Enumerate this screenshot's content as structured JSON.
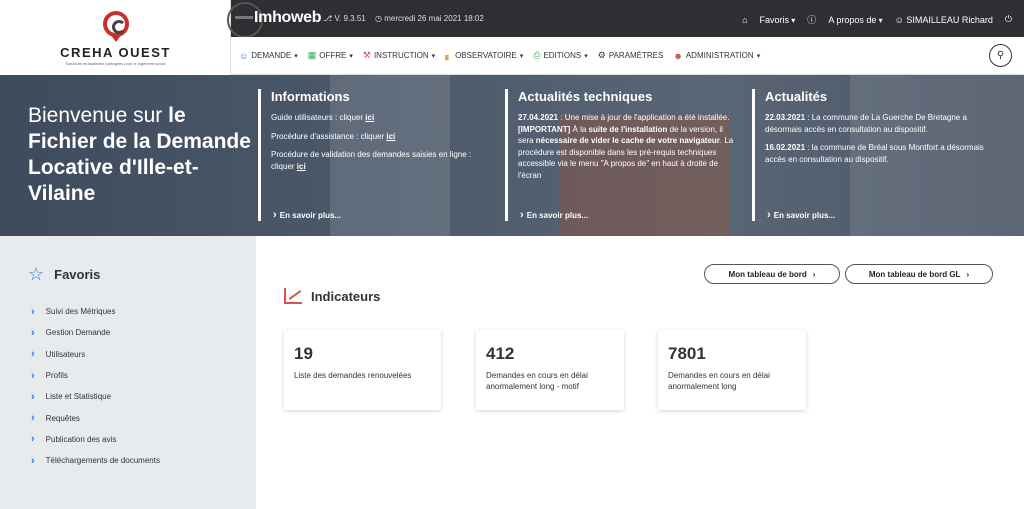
{
  "logo": {
    "name": "CREHA OUEST",
    "tagline": "Solutions mutualisées partagées pour le logement social"
  },
  "topbar": {
    "app_name": "Imhoweb",
    "version": "V. 9.3.51",
    "date": "mercredi 26 mai 2021 18:02",
    "favoris": "Favoris",
    "about": "A propos de",
    "user": "SIMAILLEAU Richard"
  },
  "menu": [
    {
      "label": "DEMANDE",
      "icon": "user-icon"
    },
    {
      "label": "OFFRE",
      "icon": "building-icon"
    },
    {
      "label": "INSTRUCTION",
      "icon": "gavel-icon"
    },
    {
      "label": "OBSERVATOIRE",
      "icon": "chart-icon"
    },
    {
      "label": "EDITIONS",
      "icon": "print-icon"
    },
    {
      "label": "PARAMÈTRES",
      "icon": "cogs-icon"
    },
    {
      "label": "ADMINISTRATION",
      "icon": "users-icon"
    }
  ],
  "hero": {
    "title_light": "Bienvenue sur",
    "title_bold_1": "le",
    "title_bold_2": "Fichier de la Demande Locative d'Ille-et-Vilaine",
    "columns": [
      {
        "title": "Informations",
        "paragraphs": [
          {
            "text": "Guide utilisateurs : cliquer ",
            "link": "ici"
          },
          {
            "text": "Procédure d'assistance : cliquer ",
            "link": "ici"
          },
          {
            "text": "Procédure de validation des demandes saisies en ligne : cliquer ",
            "link": "ici"
          }
        ],
        "more": "En savoir plus..."
      },
      {
        "title": "Actualités techniques",
        "date": "27.04.2021",
        "body": " : Une mise à jour de l'application a été installée.",
        "important": "[IMPORTANT]",
        "body2": " À la ",
        "b1": "suite de l'installation",
        "body3": " de la version, il sera ",
        "b2": "nécessaire de vider le cache de votre navigateur",
        "body4": ". La procédure est disponible dans les pré-requis techniques accessible via le menu \"A propos de\" en haut à droite de l'écran",
        "more": "En savoir plus..."
      },
      {
        "title": "Actualités",
        "items": [
          {
            "date": "22.03.2021",
            "text": " : La commune de La Guerche De Bretagne a désormais accès en consultation au dispositif."
          },
          {
            "date": "16.02.2021",
            "text": " : la commune de Bréal sous Montfort a désormais accès en consultation au dispositif."
          }
        ],
        "more": "En savoir plus..."
      }
    ]
  },
  "sidebar": {
    "title": "Favoris",
    "items": [
      "Suivi des Métriques",
      "Gestion Demande",
      "Utilisateurs",
      "Profils",
      "Liste et Statistique",
      "Requêtes",
      "Publication des avis",
      "Téléchargements de documents"
    ]
  },
  "main": {
    "btn_dashboard": "Mon tableau de bord",
    "btn_dashboard_gl": "Mon tableau de bord GL",
    "indicators_title": "Indicateurs",
    "cards": [
      {
        "value": "19",
        "label": "Liste des demandes renouvelées"
      },
      {
        "value": "412",
        "label": "Demandes en cours en délai anormalement long - motif"
      },
      {
        "value": "7801",
        "label": "Demandes en cours en délai anormalement long"
      }
    ]
  }
}
